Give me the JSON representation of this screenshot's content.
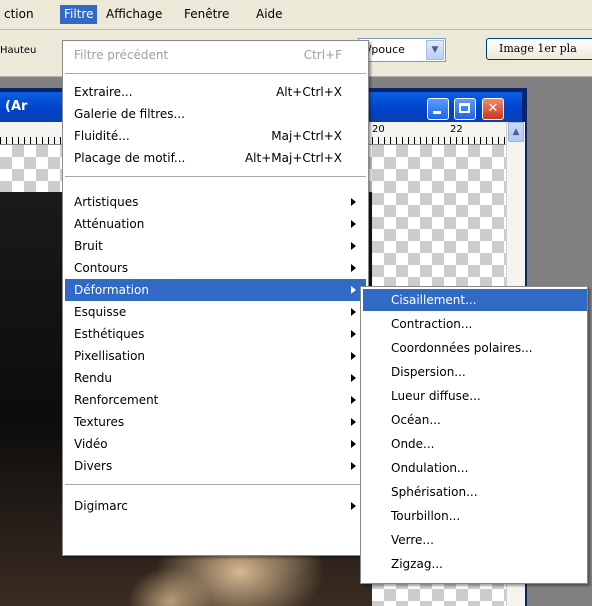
{
  "menubar": {
    "items": [
      "ction",
      "Filtre",
      "Affichage",
      "Fenêtre",
      "Aide"
    ]
  },
  "options_bar": {
    "height_label": "Hauteu",
    "unit_value": "s/pouce",
    "image_button": "Image 1er pla"
  },
  "document": {
    "title": "(Ar",
    "ruler_labels": [
      "20",
      "22"
    ]
  },
  "filtre_menu": {
    "previous_filter": {
      "label": "Filtre précédent",
      "shortcut": "Ctrl+F"
    },
    "group1": [
      {
        "label": "Extraire...",
        "shortcut": "Alt+Ctrl+X"
      },
      {
        "label": "Galerie de filtres...",
        "shortcut": ""
      },
      {
        "label": "Fluidité...",
        "shortcut": "Maj+Ctrl+X"
      },
      {
        "label": "Placage de motif...",
        "shortcut": "Alt+Maj+Ctrl+X"
      }
    ],
    "group2": [
      "Artistiques",
      "Atténuation",
      "Bruit",
      "Contours",
      "Déformation",
      "Esquisse",
      "Esthétiques",
      "Pixellisation",
      "Rendu",
      "Renforcement",
      "Textures",
      "Vidéo",
      "Divers"
    ],
    "highlighted": "Déformation",
    "group3": [
      "Digimarc"
    ]
  },
  "deformation_submenu": {
    "items": [
      "Cisaillement...",
      "Contraction...",
      "Coordonnées polaires...",
      "Dispersion...",
      "Lueur diffuse...",
      "Océan...",
      "Onde...",
      "Ondulation...",
      "Sphérisation...",
      "Tourbillon...",
      "Verre...",
      "Zigzag..."
    ],
    "highlighted": "Cisaillement..."
  },
  "colors": {
    "menu_highlight": "#316ac5",
    "title_bar": "#0a5fe3",
    "menubar_bg": "#ece9d8"
  }
}
